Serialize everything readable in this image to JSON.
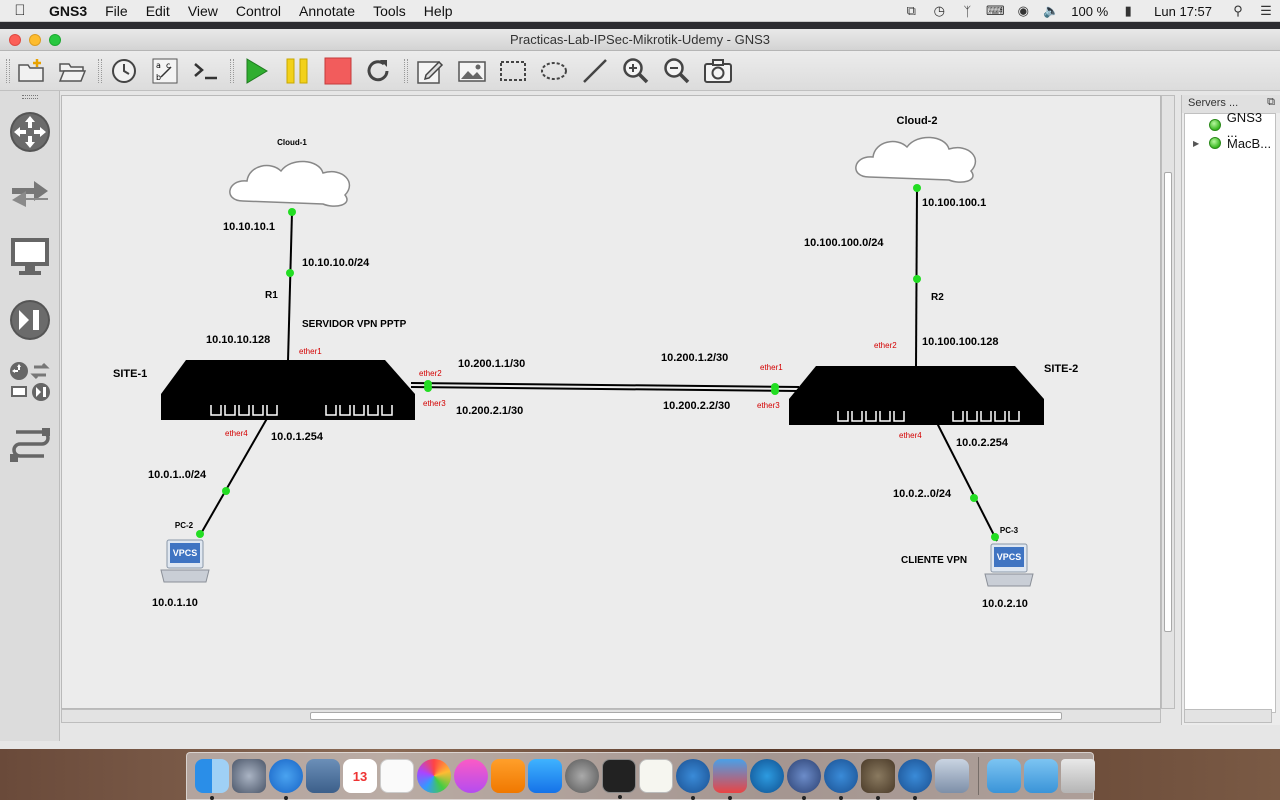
{
  "menubar": {
    "app_name": "GNS3",
    "items": [
      "File",
      "Edit",
      "View",
      "Control",
      "Annotate",
      "Tools",
      "Help"
    ],
    "battery": "100 %",
    "clock": "Lun 17:57"
  },
  "window": {
    "title": "Practicas-Lab-IPSec-Mikrotik-Udemy - GNS3"
  },
  "servers": {
    "header": "Servers ...",
    "items": [
      {
        "label": "GNS3 ..."
      },
      {
        "label": "MacB..."
      }
    ]
  },
  "diagram": {
    "cloud1": {
      "name": "Cloud-1",
      "ip": "10.10.10.1"
    },
    "cloud2": {
      "name": "Cloud-2",
      "ip": "10.100.100.1"
    },
    "r1": {
      "label": "R1",
      "net": "10.10.10.0/24",
      "ip": "10.10.10.128",
      "note": "SERVIDOR VPN PPTP"
    },
    "r2": {
      "label": "R2",
      "net": "10.100.100.0/24",
      "ip": "10.100.100.128"
    },
    "site1": {
      "name": "SITE-1",
      "ether1": "ether1",
      "ether2": "ether2",
      "ether3": "ether3",
      "ether4": "ether4",
      "lan_ip": "10.0.1.254"
    },
    "site2": {
      "name": "SITE-2",
      "ether1": "ether1",
      "ether2": "ether2",
      "ether3": "ether3",
      "ether4": "ether4",
      "lan_ip": "10.0.2.254"
    },
    "links": {
      "l1_site1": "10.200.1.1/30",
      "l1_site2": "10.200.1.2/30",
      "l2_site1": "10.200.2.1/30",
      "l2_site2": "10.200.2.2/30"
    },
    "lan1": "10.0.1..0/24",
    "lan2": "10.0.2..0/24",
    "pc2": {
      "name": "PC-2",
      "badge": "VPCS",
      "ip": "10.0.1.10"
    },
    "pc3": {
      "name": "PC-3",
      "badge": "VPCS",
      "ip": "10.0.2.10",
      "note": "CLIENTE VPN"
    }
  },
  "colors": {
    "link_dot": "#22dd22",
    "interface_label": "#d40000",
    "router": "#000000"
  }
}
